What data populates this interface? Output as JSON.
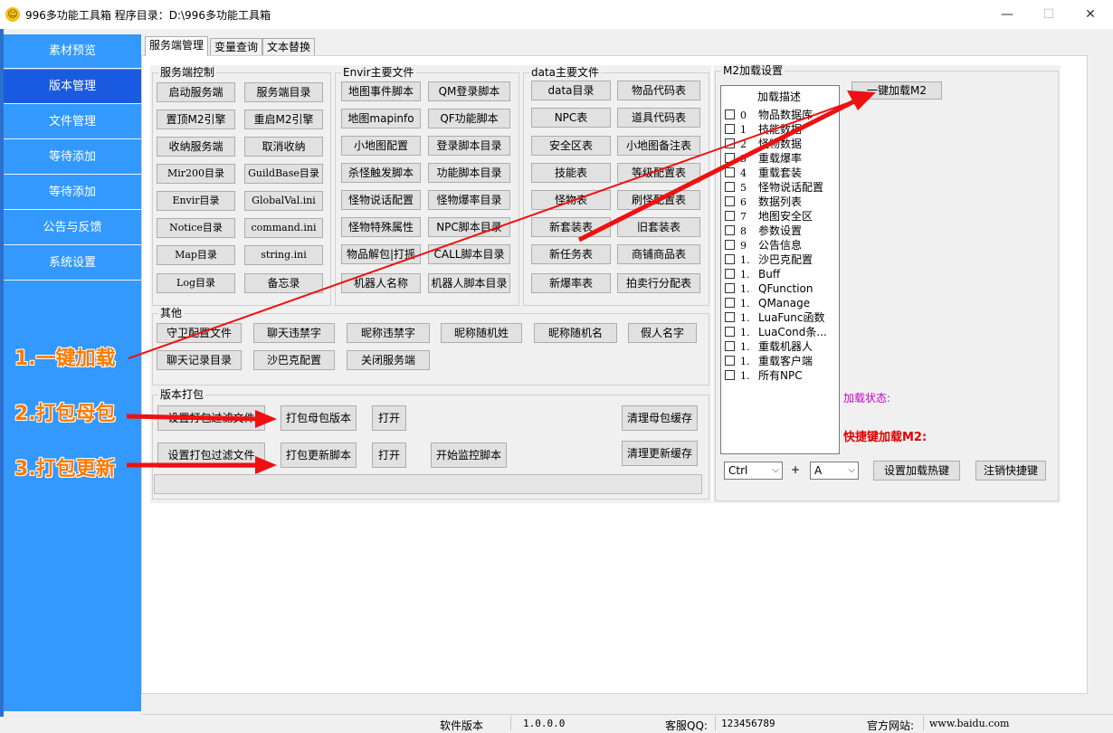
{
  "window": {
    "title": "996多功能工具箱   程序目录：D:\\996多功能工具箱",
    "minimize_label": "—",
    "maximize_label": "☐",
    "close_label": "✕"
  },
  "sidebar": {
    "items": [
      {
        "label": "素材预览"
      },
      {
        "label": "版本管理"
      },
      {
        "label": "文件管理"
      },
      {
        "label": "等待添加"
      },
      {
        "label": "等待添加"
      },
      {
        "label": "公告与反馈"
      },
      {
        "label": "系统设置"
      }
    ]
  },
  "tabs": [
    {
      "label": "服务端管理"
    },
    {
      "label": "变量查询"
    },
    {
      "label": "文本替换"
    }
  ],
  "groups": {
    "server_control": {
      "title": "服务端控制",
      "buttons": [
        "启动服务端",
        "服务端目录",
        "置顶M2引擎",
        "重启M2引擎",
        "收纳服务端",
        "取消收纳",
        "Mir200目录",
        "GuildBase目录",
        "Envir目录",
        "GlobalVal.ini",
        "Notice目录",
        "command.ini",
        "Map目录",
        "string.ini",
        "Log目录",
        "备忘录"
      ]
    },
    "envir_files": {
      "title": "Envir主要文件",
      "buttons": [
        "地图事件脚本",
        "QM登录脚本",
        "地图mapinfo",
        "QF功能脚本",
        "小地图配置",
        "登录脚本目录",
        "杀怪触发脚本",
        "功能脚本目录",
        "怪物说话配置",
        "怪物爆率目录",
        "怪物特殊属性",
        "NPC脚本目录",
        "物品解包|打摇",
        "CALL脚本目录",
        "机器人名称",
        "机器人脚本目录"
      ]
    },
    "data_files": {
      "title": "data主要文件",
      "buttons": [
        "data目录",
        "物品代码表",
        "NPC表",
        "道具代码表",
        "安全区表",
        "小地图备注表",
        "技能表",
        "等级配置表",
        "怪物表",
        "刷怪配置表",
        "新套装表",
        "旧套装表",
        "新任务表",
        "商铺商品表",
        "新爆率表",
        "拍卖行分配表"
      ]
    },
    "other": {
      "title": "其他",
      "buttons": [
        "守卫配置文件",
        "聊天违禁字",
        "昵称违禁字",
        "昵称随机姓",
        "昵称随机名",
        "假人名字",
        "聊天记录目录",
        "沙巴克配置",
        "关闭服务端"
      ]
    },
    "packaging": {
      "title": "版本打包",
      "buttons": [
        "设置打包过滤文件",
        "打包母包版本",
        "打开",
        "清理母包缓存",
        "设置打包过滤文件",
        "打包更新脚本",
        "打开",
        "开始监控脚本",
        "清理更新缓存"
      ]
    },
    "m2": {
      "title": "M2加载设置",
      "list_header": "加载描述",
      "list_items": [
        {
          "idx": "0",
          "label": "物品数据库"
        },
        {
          "idx": "1",
          "label": "技能数据"
        },
        {
          "idx": "2",
          "label": "怪物数据"
        },
        {
          "idx": "3",
          "label": "重载爆率"
        },
        {
          "idx": "4",
          "label": "重载套装"
        },
        {
          "idx": "5",
          "label": "怪物说话配置"
        },
        {
          "idx": "6",
          "label": "数据列表"
        },
        {
          "idx": "7",
          "label": "地图安全区"
        },
        {
          "idx": "8",
          "label": "参数设置"
        },
        {
          "idx": "9",
          "label": "公告信息"
        },
        {
          "idx": "1.",
          "label": "沙巴克配置"
        },
        {
          "idx": "1.",
          "label": "Buff"
        },
        {
          "idx": "1.",
          "label": "QFunction"
        },
        {
          "idx": "1.",
          "label": "QManage"
        },
        {
          "idx": "1.",
          "label": "LuaFunc函数"
        },
        {
          "idx": "1.",
          "label": "LuaCond条..."
        },
        {
          "idx": "1.",
          "label": "重载机器人"
        },
        {
          "idx": "1.",
          "label": "重载客户端"
        },
        {
          "idx": "1.",
          "label": "所有NPC"
        }
      ],
      "load_button": "一键加载M2",
      "status_label": "加载状态:",
      "hotkey_label": "快捷键加载M2:",
      "modifier_value": "Ctrl",
      "plus": "+",
      "key_value": "A",
      "set_hotkey_button": "设置加载热键",
      "remove_hotkey_button": "注销快捷键"
    }
  },
  "annotations": [
    "1.一键加载",
    "2.打包母包",
    "3.打包更新"
  ],
  "statusbar": {
    "version_label": "软件版本",
    "version_value": "1.0.0.0",
    "qq_label": "客服QQ:",
    "qq_value": "123456789",
    "site_label": "官方网站:",
    "site_value": "www.baidu.com"
  },
  "colors": {
    "sidebar": "#3399ff",
    "sidebar_active": "#1a5ae0",
    "annotation": "#ff7a00",
    "arrow": "#ee1111",
    "status_label": "#cc00cc",
    "hotkey_label": "#dd0000"
  }
}
